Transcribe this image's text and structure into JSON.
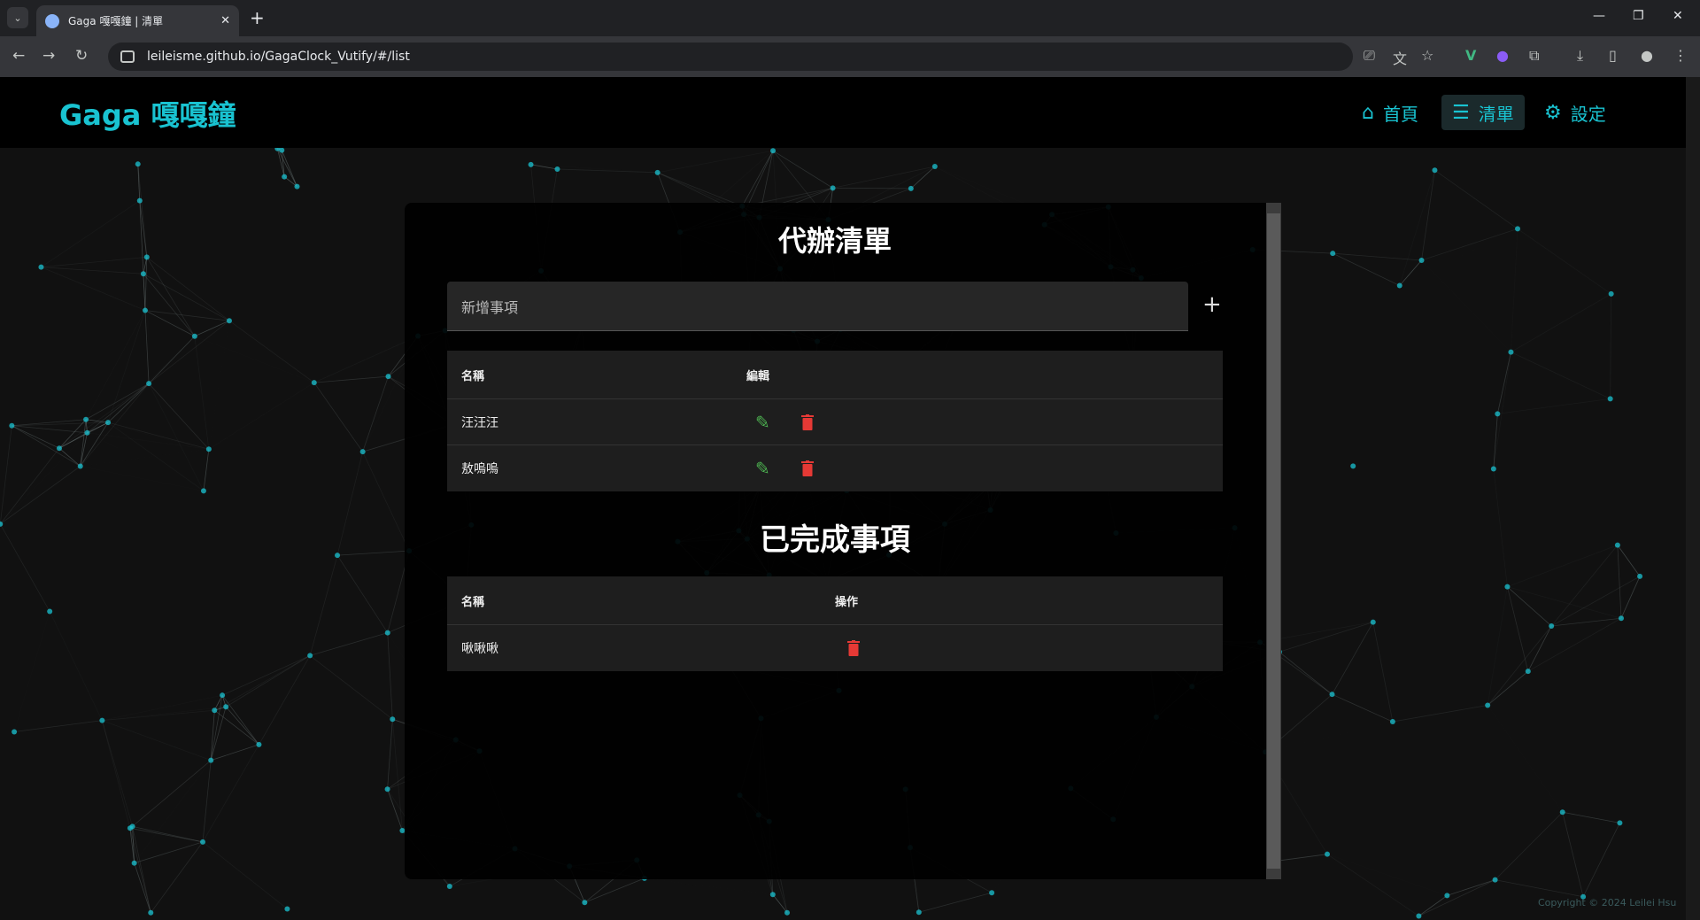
{
  "browser": {
    "tab_title": "Gaga 嘎嘎鐘 | 清單",
    "url": "leileisme.github.io/GagaClock_Vutify/#/list"
  },
  "app": {
    "brand": "Gaga 嘎嘎鐘",
    "nav": [
      {
        "label": "首頁",
        "icon": "home-icon"
      },
      {
        "label": "清單",
        "icon": "list-edit-icon"
      },
      {
        "label": "設定",
        "icon": "gear-icon"
      }
    ]
  },
  "todo": {
    "title": "代辦清單",
    "input_placeholder": "新增事項",
    "add_label": "+",
    "headers": {
      "name": "名稱",
      "edit": "編輯"
    },
    "items": [
      {
        "name": "汪汪汪"
      },
      {
        "name": "敖嗚嗚"
      }
    ]
  },
  "done": {
    "title": "已完成事項",
    "headers": {
      "name": "名稱",
      "action": "操作"
    },
    "items": [
      {
        "name": "啾啾啾"
      }
    ]
  },
  "footer": "Copyright © 2024 Leilei Hsu",
  "colors": {
    "accent": "#19c3d1",
    "edit": "#4caf50",
    "delete": "#e53935"
  }
}
